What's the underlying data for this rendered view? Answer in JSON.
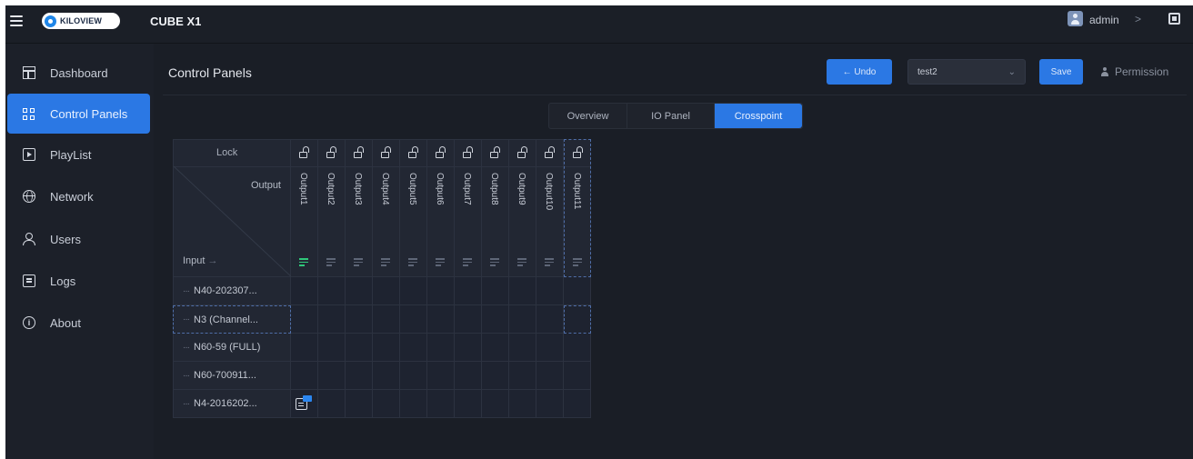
{
  "app": {
    "brand": "KILOVIEW",
    "product": "CUBE X1",
    "user": "admin",
    "user_chevron": ">"
  },
  "sidebar": {
    "items": [
      {
        "label": "Dashboard",
        "icon": "dashboard-icon"
      },
      {
        "label": "Control Panels",
        "icon": "grid-icon",
        "active": true
      },
      {
        "label": "PlayList",
        "icon": "playlist-icon"
      },
      {
        "label": "Network",
        "icon": "globe-icon"
      },
      {
        "label": "Users",
        "icon": "users-icon"
      },
      {
        "label": "Logs",
        "icon": "logs-icon"
      },
      {
        "label": "About",
        "icon": "info-icon"
      }
    ]
  },
  "header": {
    "title": "Control Panels",
    "undo_label": "← Undo",
    "panel_select": "test2",
    "save_label": "Save",
    "permission_label": "Permission"
  },
  "tabs": [
    {
      "label": "Overview",
      "active": false
    },
    {
      "label": "IO Panel",
      "active": false
    },
    {
      "label": "Crosspoint",
      "active": true
    }
  ],
  "crosspoint": {
    "lock_label": "Lock",
    "output_label": "Output",
    "input_label": "Input",
    "input_arrow": "→",
    "outputs": [
      "Output1",
      "Output2",
      "Output3",
      "Output4",
      "Output5",
      "Output6",
      "Output7",
      "Output8",
      "Output9",
      "Output10",
      "Output11"
    ],
    "selected_output_index": 10,
    "active_output_index": 0,
    "inputs": [
      "N40-202307...",
      "N3 (Channel...",
      "N60-59 (FULL)",
      "N60-700911...",
      "N4-2016202..."
    ],
    "selected_input_index": 1,
    "routes": [
      {
        "input": 4,
        "output": 0
      }
    ],
    "colors": {
      "accent": "#2b78e4",
      "route_active": "#2fc77a"
    }
  }
}
